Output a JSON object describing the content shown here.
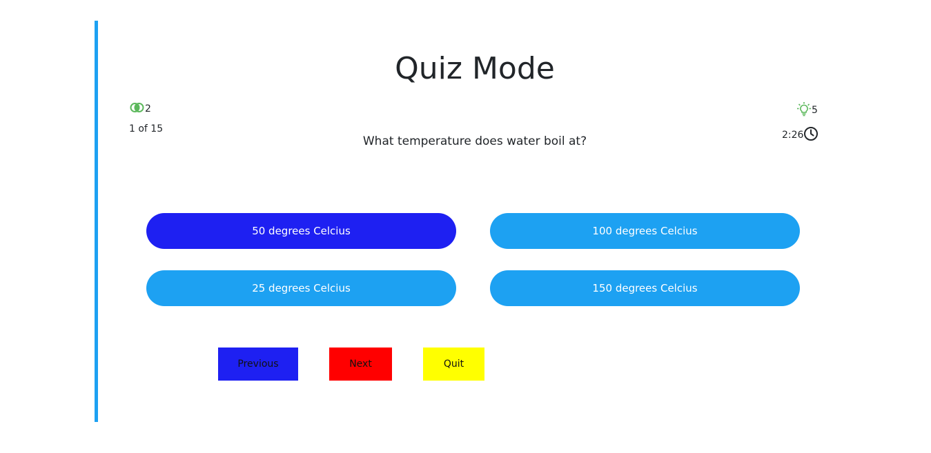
{
  "header": {
    "title": "Quiz Mode"
  },
  "stats": {
    "lifeline_count": "2",
    "hint_count": "5",
    "question_counter": "1 of 15",
    "time_remaining": "2:26",
    "lifeline_icon": "fifty-fifty-icon",
    "hint_icon": "lightbulb-icon",
    "timer_icon": "clock-icon",
    "icon_color": "#5cb85c"
  },
  "question": {
    "text": "What temperature does water boil at?"
  },
  "options": [
    {
      "label": "50 degrees Celcius",
      "selected": true
    },
    {
      "label": "100 degrees Celcius",
      "selected": false
    },
    {
      "label": "25 degrees Celcius",
      "selected": false
    },
    {
      "label": "150 degrees Celcius",
      "selected": false
    }
  ],
  "controls": {
    "previous_label": "Previous",
    "next_label": "Next",
    "quit_label": "Quit"
  },
  "colors": {
    "accent": "#1da1f2",
    "selected_option": "#1e20f2",
    "previous_button": "#1e20f2",
    "next_button": "#ff0000",
    "quit_button": "#ffff00"
  }
}
